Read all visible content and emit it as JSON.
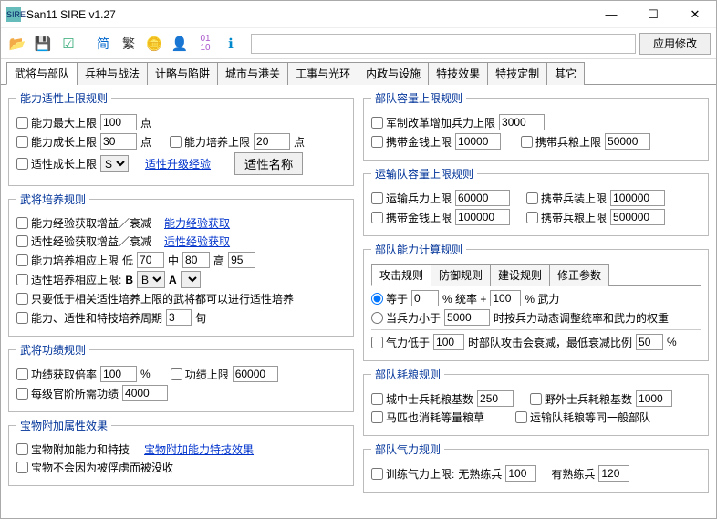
{
  "window": {
    "title": "San11 SIRE v1.27"
  },
  "toolbar": {
    "apply": "应用修改",
    "btn_simp": "简",
    "btn_trad": "繁"
  },
  "tabs": [
    "武将与部队",
    "兵种与战法",
    "计略与陷阱",
    "城市与港关",
    "工事与光环",
    "内政与设施",
    "特技效果",
    "特技定制",
    "其它"
  ],
  "left": {
    "cap": {
      "legend": "能力适性上限规则",
      "max_label": "能力最大上限",
      "max_val": "100",
      "pt": "点",
      "grow_label": "能力成长上限",
      "grow_val": "30",
      "train_label": "能力培养上限",
      "train_val": "20",
      "aptgrow_label": "适性成长上限",
      "aptgrow_sel": "S",
      "link_upgrade": "适性升级经验",
      "btn_name": "适性名称"
    },
    "train": {
      "legend": "武将培养规则",
      "exp_gain_label": "能力经验获取增益／衰减",
      "exp_link": "能力经验获取",
      "apt_gain_label": "适性经验获取增益／衰减",
      "apt_link": "适性经验获取",
      "rel_label": "能力培养相应上限",
      "low": "低",
      "low_v": "70",
      "mid": "中",
      "mid_v": "80",
      "hi": "高",
      "hi_v": "95",
      "aptrel_label": "适性培养相应上限:",
      "b": "B",
      "bsel": "B",
      "a": "A",
      "below_label": "只要低于相关适性培养上限的武将都可以进行适性培养",
      "cycle_label": "能力、适性和特技培养周期",
      "cycle_v": "3",
      "cycle_unit": "旬"
    },
    "merit": {
      "legend": "武将功绩规则",
      "rate_label": "功绩获取倍率",
      "rate_v": "100",
      "pct": "%",
      "cap_label": "功绩上限",
      "cap_v": "60000",
      "rank_label": "每级官阶所需功绩",
      "rank_v": "4000"
    },
    "item": {
      "legend": "宝物附加属性效果",
      "add_label": "宝物附加能力和特技",
      "link": "宝物附加能力特技效果",
      "noloss_label": "宝物不会因为被俘虏而被没收"
    }
  },
  "right": {
    "unitcap": {
      "legend": "部队容量上限规则",
      "reform_label": "军制改革增加兵力上限",
      "reform_v": "3000",
      "gold_label": "携带金钱上限",
      "gold_v": "10000",
      "food_label": "携带兵粮上限",
      "food_v": "50000"
    },
    "transcap": {
      "legend": "运输队容量上限规则",
      "troop_label": "运输兵力上限",
      "troop_v": "60000",
      "equip_label": "携带兵装上限",
      "equip_v": "100000",
      "gold_label": "携带金钱上限",
      "gold_v": "100000",
      "food_label": "携带兵粮上限",
      "food_v": "500000"
    },
    "calc": {
      "legend": "部队能力计算规则",
      "subtabs": [
        "攻击规则",
        "防御规则",
        "建设规则",
        "修正参数"
      ],
      "eq_label": "等于",
      "eq_v1": "0",
      "eq_t1": "% 统率 +",
      "eq_v2": "100",
      "eq_t2": "% 武力",
      "lt_label": "当兵力小于",
      "lt_v": "5000",
      "lt_t": "时按兵力动态调整统率和武力的权重",
      "morale_label": "气力低于",
      "morale_v": "100",
      "morale_t": "时部队攻击会衰减，最低衰减比例",
      "morale_v2": "50",
      "pct": "%"
    },
    "food": {
      "legend": "部队耗粮规则",
      "city_label": "城中士兵耗粮基数",
      "city_v": "250",
      "field_label": "野外士兵耗粮基数",
      "field_v": "1000",
      "horse_label": "马匹也消耗等量粮草",
      "trans_label": "运输队耗粮等同一般部队"
    },
    "morale": {
      "legend": "部队气力规则",
      "label": "训练气力上限:",
      "no_label": "无熟练兵",
      "no_v": "100",
      "yes_label": "有熟练兵",
      "yes_v": "120"
    }
  }
}
